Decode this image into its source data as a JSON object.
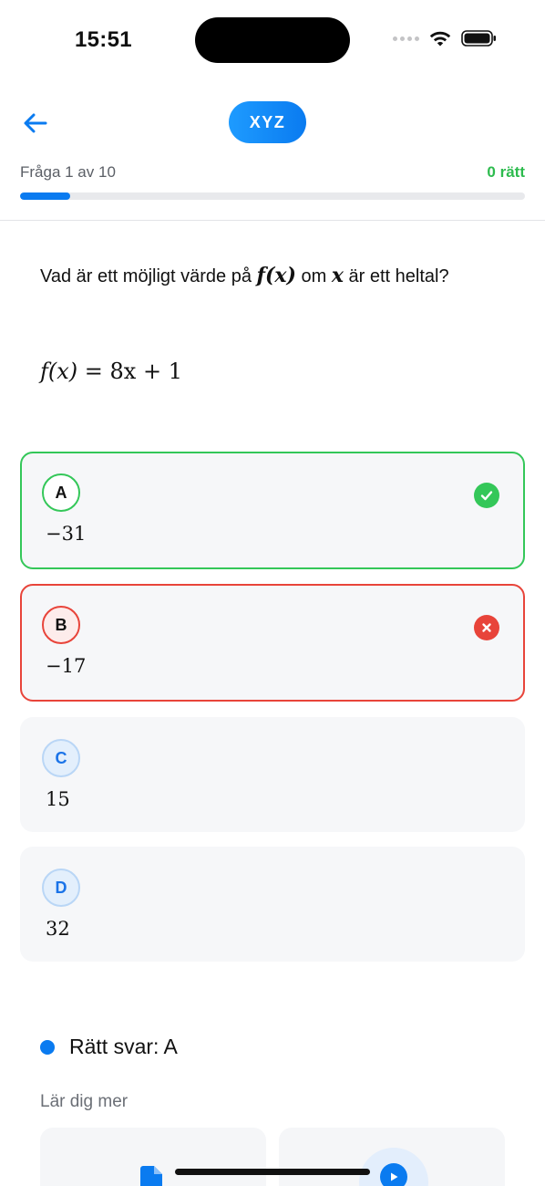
{
  "status": {
    "time": "15:51"
  },
  "header": {
    "brand": "XYZ"
  },
  "progress": {
    "label": "Fråga 1 av 10",
    "score": "0 rätt",
    "fraction": 0.1
  },
  "question": {
    "text_before": "Vad är ett möjligt värde på ",
    "fx": "f(x)",
    "text_mid": " om ",
    "x": "x",
    "text_after": " är ett heltal?",
    "formula": {
      "lhs": "f(x)",
      "eq": " = ",
      "rhs": "8x + 1"
    }
  },
  "options": [
    {
      "letter": "A",
      "value": "−31",
      "state": "correct"
    },
    {
      "letter": "B",
      "value": "−17",
      "state": "wrong"
    },
    {
      "letter": "C",
      "value": "15",
      "state": "neutral"
    },
    {
      "letter": "D",
      "value": "32",
      "state": "neutral"
    }
  ],
  "answer": {
    "label": "Rätt svar: A"
  },
  "learn_more": {
    "label": "Lär dig mer",
    "cards": [
      "document-icon",
      "play-icon"
    ]
  },
  "colors": {
    "accent": "#0a7bf0",
    "correct": "#34c759",
    "wrong": "#e8443a"
  }
}
